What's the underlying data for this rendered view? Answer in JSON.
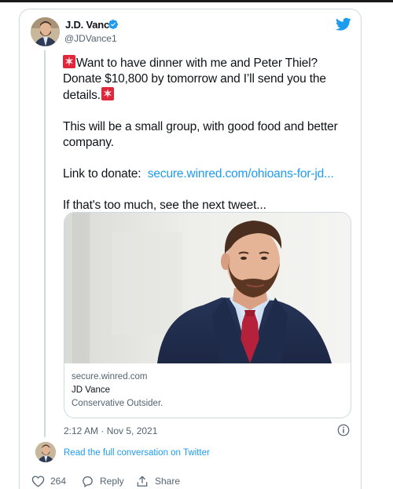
{
  "author": {
    "name": "J.D. Vance",
    "handle": "@JDVance1",
    "verified": true
  },
  "tweet": {
    "line1": "Want to have dinner with me and Peter Thiel? Donate $10,800 by tomorrow and I’ll send you the details.",
    "line2": "This will be a small group, with good food and better company.",
    "link_prefix": "Link to donate:",
    "link_text": "secure.winred.com/ohioans-for-jd...",
    "line4": "If that's too much, see the next tweet..."
  },
  "card": {
    "domain": "secure.winred.com",
    "title": "JD Vance",
    "description": "Conservative Outsider."
  },
  "timestamp": "2:12 AM · Nov 5, 2021",
  "read_full": "Read the full conversation on Twitter",
  "actions": {
    "like_count": "264",
    "reply_label": "Reply",
    "share_label": "Share"
  },
  "colors": {
    "accent": "#1d9bf0",
    "text": "#0f1419",
    "muted": "#536471",
    "border": "#cfd9de",
    "siren": "#e0263a"
  },
  "icons": [
    "verified-badge-icon",
    "twitter-logo-icon",
    "siren-emoji-icon",
    "info-icon",
    "heart-icon",
    "reply-icon",
    "share-icon"
  ]
}
